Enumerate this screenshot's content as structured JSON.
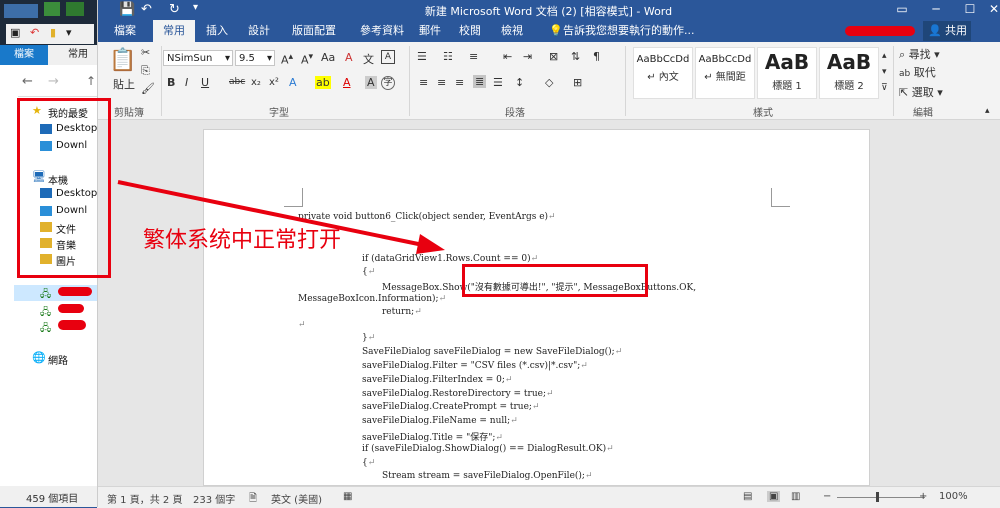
{
  "word": {
    "title": "新建 Microsoft Word 文档 (2) [相容模式] - Word",
    "tabs": [
      "檔案",
      "常用",
      "插入",
      "設計",
      "版面配置",
      "參考資料",
      "郵件",
      "校閱",
      "檢視"
    ],
    "active_tab": "常用",
    "tellme": "告訴我您想要執行的動作...",
    "share": "共用",
    "ribbon": {
      "clipboard": {
        "paste": "貼上",
        "label": "剪貼簿"
      },
      "font": {
        "name": "NSimSun",
        "size": "9.5",
        "label": "字型"
      },
      "paragraph": {
        "label": "段落"
      },
      "styles": {
        "label": "樣式",
        "items": [
          {
            "preview": "AaBbCcDd",
            "name": "↵ 內文"
          },
          {
            "preview": "AaBbCcDd",
            "name": "↵ 無間距"
          },
          {
            "preview": "AaB",
            "name": "標題 1"
          },
          {
            "preview": "AaB",
            "name": "標題 2"
          }
        ]
      },
      "editing": {
        "find": "尋找",
        "replace": "取代",
        "select": "選取",
        "label": "編輯"
      }
    },
    "status": {
      "page": "第 1 頁，共 2 頁",
      "words": "233 個字",
      "lang": "英文 (美國)",
      "zoom": "100%"
    }
  },
  "explorer": {
    "tabs": [
      "檔案",
      "常用"
    ],
    "quick_access": "我的最愛",
    "items_fav": [
      "Desktop",
      "Downl"
    ],
    "this_pc": "本機",
    "items_pc": [
      "Desktop",
      "Downl",
      "文件",
      "音樂",
      "圖片"
    ],
    "network": "網路",
    "count": "459 個項目"
  },
  "annotation": {
    "text": "繁体系统中正常打开"
  },
  "code_lines": [
    "private void button6_Click(object sender, EventArgs e)",
    "if (dataGridView1.Rows.Count == 0)",
    "{",
    "MessageBox.Show(\"沒有數據可導出!\", \"提示\", MessageBoxButtons.OK,",
    "MessageBoxIcon.Information);",
    "return;",
    "}",
    "SaveFileDialog saveFileDialog = new SaveFileDialog();",
    "saveFileDialog.Filter = \"CSV files (*.csv)|*.csv\";",
    "saveFileDialog.FilterIndex = 0;",
    "saveFileDialog.RestoreDirectory = true;",
    "saveFileDialog.CreatePrompt = true;",
    "saveFileDialog.FileName = null;",
    "saveFileDialog.Title = \"保存\";",
    "if (saveFileDialog.ShowDialog() == DialogResult.OK)",
    "{",
    "Stream stream = saveFileDialog.OpenFile();"
  ],
  "colors": {
    "word_blue": "#2b579a",
    "annotation_red": "#e8000f"
  }
}
